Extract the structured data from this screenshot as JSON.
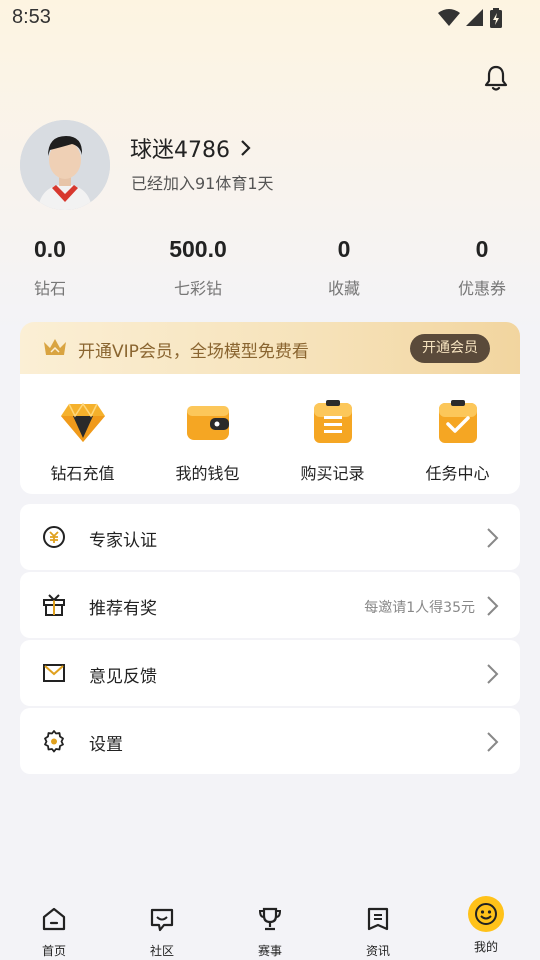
{
  "status_bar": {
    "time": "8:53"
  },
  "profile": {
    "username": "球迷4786",
    "joined_text": "已经加入91体育1天"
  },
  "stats": [
    {
      "value": "0.0",
      "label": "钻石"
    },
    {
      "value": "500.0",
      "label": "七彩钻"
    },
    {
      "value": "0",
      "label": "收藏"
    },
    {
      "value": "0",
      "label": "优惠券"
    }
  ],
  "vip": {
    "text": "开通VIP会员，全场模型免费看",
    "button_label": "开通会员"
  },
  "grid": [
    {
      "label": "钻石充值",
      "icon": "diamond-icon"
    },
    {
      "label": "我的钱包",
      "icon": "wallet-icon"
    },
    {
      "label": "购买记录",
      "icon": "clipboard-list-icon"
    },
    {
      "label": "任务中心",
      "icon": "clipboard-check-icon"
    }
  ],
  "menu": [
    {
      "label": "专家认证",
      "hint": "",
      "icon": "coin-icon"
    },
    {
      "label": "推荐有奖",
      "hint": "每邀请1人得35元",
      "icon": "gift-icon"
    },
    {
      "label": "意见反馈",
      "hint": "",
      "icon": "mail-icon"
    },
    {
      "label": "设置",
      "hint": "",
      "icon": "gear-icon"
    }
  ],
  "tabs": [
    {
      "label": "首页",
      "icon": "home-icon"
    },
    {
      "label": "社区",
      "icon": "chat-icon"
    },
    {
      "label": "赛事",
      "icon": "trophy-icon"
    },
    {
      "label": "资讯",
      "icon": "news-icon"
    },
    {
      "label": "我的",
      "icon": "smiley-icon",
      "active": true
    }
  ],
  "colors": {
    "accent": "#ffc21a",
    "vip_text": "#8a6530",
    "vip_button": "#5a4a3a",
    "icon_orange": "#f5a623"
  }
}
